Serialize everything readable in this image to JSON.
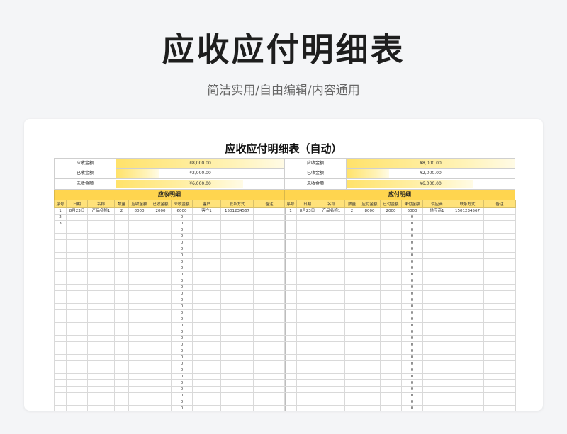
{
  "header": {
    "title": "应收应付明细表",
    "subtitle": "简洁实用/自由编辑/内容通用"
  },
  "sheet": {
    "title": "应收应付明细表（自动）"
  },
  "receivable": {
    "summary": [
      {
        "label": "应收金额",
        "value": "¥8,000.00",
        "fill": 1.0
      },
      {
        "label": "已收金额",
        "value": "¥2,000.00",
        "fill": 0.25
      },
      {
        "label": "未收金额",
        "value": "¥6,000.00",
        "fill": 0.75
      }
    ],
    "section_title": "应收明细",
    "columns": [
      "序号",
      "日期",
      "名称",
      "数量",
      "应收金额",
      "已收金额",
      "未收金额",
      "客户",
      "联系方式",
      "备注"
    ],
    "rows": [
      [
        "1",
        "8月23日",
        "产品名称1",
        "2",
        "8000",
        "2000",
        "6000",
        "客户1",
        "1501234567",
        ""
      ],
      [
        "2",
        "",
        "",
        "",
        "",
        "",
        "0",
        "",
        "",
        ""
      ],
      [
        "3",
        "",
        "",
        "",
        "",
        "",
        "0",
        "",
        "",
        ""
      ]
    ],
    "empty_value": "0"
  },
  "payable": {
    "summary": [
      {
        "label": "应收金额",
        "value": "¥8,000.00",
        "fill": 1.0
      },
      {
        "label": "已收金额",
        "value": "¥2,000.00",
        "fill": 0.25
      },
      {
        "label": "未收金额",
        "value": "¥6,000.00",
        "fill": 0.75
      }
    ],
    "section_title": "应付明细",
    "columns": [
      "序号",
      "日期",
      "名称",
      "数量",
      "应付金额",
      "已付金额",
      "未付金额",
      "供应商",
      "联系方式",
      "备注"
    ],
    "rows": [
      [
        "1",
        "8月23日",
        "产品名称1",
        "2",
        "8000",
        "2000",
        "6000",
        "供应商1",
        "1501234567",
        ""
      ],
      [
        "",
        "",
        "",
        "",
        "",
        "",
        "0",
        "",
        "",
        ""
      ],
      [
        "",
        "",
        "",
        "",
        "",
        "",
        "0",
        "",
        "",
        ""
      ]
    ],
    "empty_value": "0"
  },
  "colors": {
    "header_yellow": "#ffd54f",
    "column_header_yellow": "#ffe27a",
    "bar_yellow": "#ffe26a"
  }
}
